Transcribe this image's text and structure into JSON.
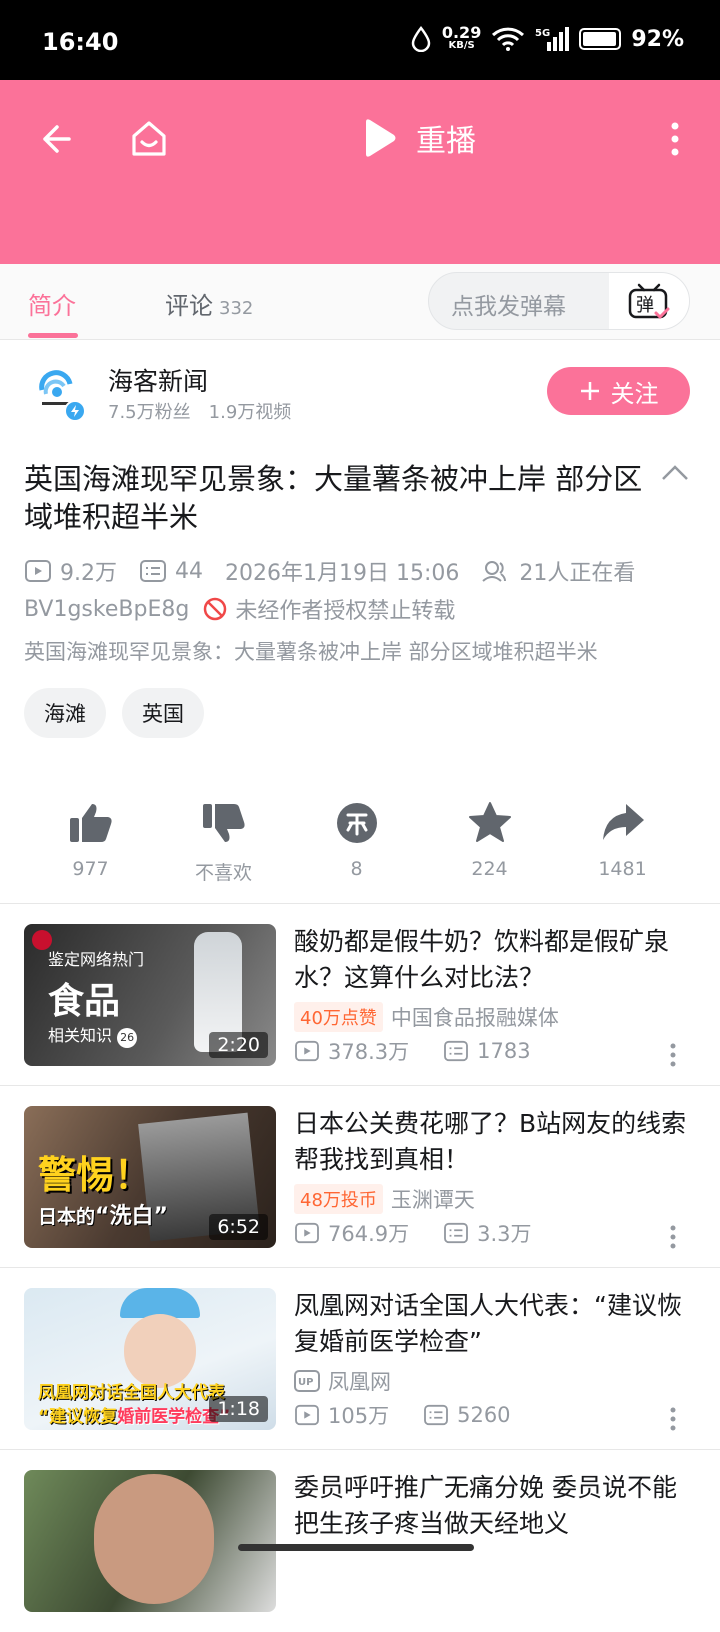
{
  "status_bar": {
    "time": "16:40",
    "net_speed": "0.29",
    "net_unit": "KB/S",
    "signal": "5G",
    "battery": "92%"
  },
  "header": {
    "replay_label": "重播",
    "accent": "#fb7299"
  },
  "tabs": [
    {
      "label": "简介",
      "active": true
    },
    {
      "label": "评论",
      "count": "332"
    }
  ],
  "danmaku": {
    "placeholder": "点我发弹幕",
    "button": "弹"
  },
  "author": {
    "name": "海客新闻",
    "fans": "7.5万粉丝",
    "videos": "1.9万视频",
    "follow_label": "关注"
  },
  "video": {
    "title": "英国海滩现罕见景象：大量薯条被冲上岸 部分区域堆积超半米",
    "views": "9.2万",
    "danmaku_count": "44",
    "date": "2026年1月19日 15:06",
    "watching": "21人正在看",
    "bvid": "BV1gskeBpE8g",
    "copyright": "未经作者授权禁止转载",
    "desc": "英国海滩现罕见景象：大量薯条被冲上岸 部分区域堆积超半米",
    "tags": [
      "海滩",
      "英国"
    ]
  },
  "actions": [
    {
      "icon": "thumbs-up-icon",
      "label": "977"
    },
    {
      "icon": "thumbs-down-icon",
      "label": "不喜欢"
    },
    {
      "icon": "coin-icon",
      "label": "8"
    },
    {
      "icon": "star-icon",
      "label": "224"
    },
    {
      "icon": "share-icon",
      "label": "1481"
    }
  ],
  "related": [
    {
      "title": "酸奶都是假牛奶？饮料都是假矿泉水？这算什么对比法？",
      "badge": "40万点赞",
      "author": "中国食品报融媒体",
      "views": "378.3万",
      "comments": "1783",
      "duration": "2:20",
      "thumb_line1": "鉴定网络热门",
      "thumb_line2": "食品",
      "thumb_line3": "相关知识",
      "thumb_num": "26"
    },
    {
      "title": "日本公关费花哪了？B站网友的线索帮我找到真相！",
      "badge": "48万投币",
      "author": "玉渊谭天",
      "views": "764.9万",
      "comments": "3.3万",
      "duration": "6:52",
      "thumb_line1": "警惕！",
      "thumb_line2": "日本的",
      "thumb_line3": "“洗白”"
    },
    {
      "title": "凤凰网对话全国人大代表：“建议恢复婚前医学检查”",
      "badge": "",
      "author": "凤凰网",
      "views": "105万",
      "comments": "5260",
      "duration": "1:18",
      "thumb_line1": "凤凰网对话全国人大代表",
      "thumb_line2": "“建议恢复",
      "thumb_line3": "婚前医学检查”"
    },
    {
      "title": "委员呼吁推广无痛分娩 委员说不能把生孩子疼当做天经地义"
    }
  ]
}
